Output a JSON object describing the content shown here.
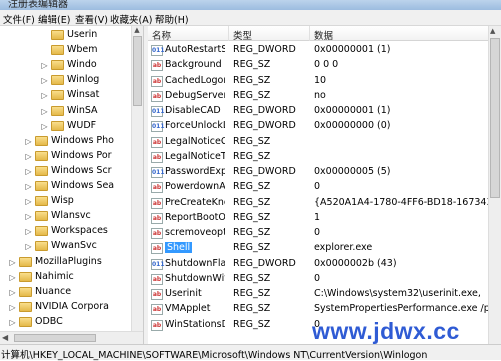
{
  "window": {
    "title": "注册表编辑器"
  },
  "menu": [
    "文件(F)",
    "编辑(E)",
    "查看(V)",
    "收藏夹(A)",
    "帮助(H)"
  ],
  "tree": [
    {
      "label": "Userin",
      "expander": "",
      "indent": 3
    },
    {
      "label": "Wbem",
      "expander": "",
      "indent": 3
    },
    {
      "label": "Windo",
      "expander": "▷",
      "indent": 3
    },
    {
      "label": "Winlog",
      "expander": "▷",
      "indent": 3
    },
    {
      "label": "Winsat",
      "expander": "▷",
      "indent": 3
    },
    {
      "label": "WinSA",
      "expander": "▷",
      "indent": 3
    },
    {
      "label": "WUDF",
      "expander": "▷",
      "indent": 3
    },
    {
      "label": "Windows Pho",
      "expander": "▷",
      "indent": 2
    },
    {
      "label": "Windows Por",
      "expander": "▷",
      "indent": 2
    },
    {
      "label": "Windows Scr",
      "expander": "▷",
      "indent": 2
    },
    {
      "label": "Windows Sea",
      "expander": "▷",
      "indent": 2
    },
    {
      "label": "Wisp",
      "expander": "▷",
      "indent": 2
    },
    {
      "label": "Wlansvc",
      "expander": "▷",
      "indent": 2
    },
    {
      "label": "Workspaces",
      "expander": "▷",
      "indent": 2
    },
    {
      "label": "WwanSvc",
      "expander": "▷",
      "indent": 2
    },
    {
      "label": "MozillaPlugins",
      "expander": "▷",
      "indent": 1
    },
    {
      "label": "Nahimic",
      "expander": "▷",
      "indent": 1
    },
    {
      "label": "Nuance",
      "expander": "▷",
      "indent": 1
    },
    {
      "label": "NVIDIA Corpora",
      "expander": "▷",
      "indent": 1
    },
    {
      "label": "ODBC",
      "expander": "▷",
      "indent": 1
    },
    {
      "label": "Oracle",
      "expander": "▷",
      "indent": 1
    }
  ],
  "columns": {
    "name": "名称",
    "type": "类型",
    "data": "数据"
  },
  "values": [
    {
      "name": "AutoRestartShell",
      "type": "REG_DWORD",
      "data": "0x00000001 (1)",
      "icon": "binary-value-icon"
    },
    {
      "name": "Background",
      "type": "REG_SZ",
      "data": "0 0 0",
      "icon": "string-value-icon"
    },
    {
      "name": "CachedLogons...",
      "type": "REG_SZ",
      "data": "10",
      "icon": "string-value-icon"
    },
    {
      "name": "DebugServerC...",
      "type": "REG_SZ",
      "data": "no",
      "icon": "string-value-icon"
    },
    {
      "name": "DisableCAD",
      "type": "REG_DWORD",
      "data": "0x00000001 (1)",
      "icon": "binary-value-icon"
    },
    {
      "name": "ForceUnlockLo...",
      "type": "REG_DWORD",
      "data": "0x00000000 (0)",
      "icon": "binary-value-icon"
    },
    {
      "name": "LegalNoticeCa...",
      "type": "REG_SZ",
      "data": "",
      "icon": "string-value-icon"
    },
    {
      "name": "LegalNoticeText",
      "type": "REG_SZ",
      "data": "",
      "icon": "string-value-icon"
    },
    {
      "name": "PasswordExpir...",
      "type": "REG_DWORD",
      "data": "0x00000005 (5)",
      "icon": "binary-value-icon"
    },
    {
      "name": "PowerdownAft...",
      "type": "REG_SZ",
      "data": "0",
      "icon": "string-value-icon"
    },
    {
      "name": "PreCreateKno...",
      "type": "REG_SZ",
      "data": "{A520A1A4-1780-4FF6-BD18-167343C5AF16}",
      "icon": "string-value-icon"
    },
    {
      "name": "ReportBootOk",
      "type": "REG_SZ",
      "data": "1",
      "icon": "string-value-icon"
    },
    {
      "name": "scremoveoption",
      "type": "REG_SZ",
      "data": "0",
      "icon": "string-value-icon"
    },
    {
      "name": "Shell",
      "type": "REG_SZ",
      "data": "explorer.exe",
      "icon": "string-value-icon",
      "selected": true
    },
    {
      "name": "ShutdownFlags",
      "type": "REG_DWORD",
      "data": "0x0000002b (43)",
      "icon": "binary-value-icon"
    },
    {
      "name": "ShutdownWith...",
      "type": "REG_SZ",
      "data": "0",
      "icon": "string-value-icon"
    },
    {
      "name": "Userinit",
      "type": "REG_SZ",
      "data": "C:\\Windows\\system32\\userinit.exe,",
      "icon": "string-value-icon"
    },
    {
      "name": "VMApplet",
      "type": "REG_SZ",
      "data": "SystemPropertiesPerformance.exe /pagefile",
      "icon": "string-value-icon"
    },
    {
      "name": "WinStationsDis...",
      "type": "REG_SZ",
      "data": "0",
      "icon": "string-value-icon"
    }
  ],
  "statusbar": {
    "path": "计算机\\HKEY_LOCAL_MACHINE\\SOFTWARE\\Microsoft\\Windows NT\\CurrentVersion\\Winlogon"
  },
  "watermark": "www.jdwx.cc",
  "colors": {
    "selection": "#3399ff",
    "watermark": "#2f5bd4"
  }
}
